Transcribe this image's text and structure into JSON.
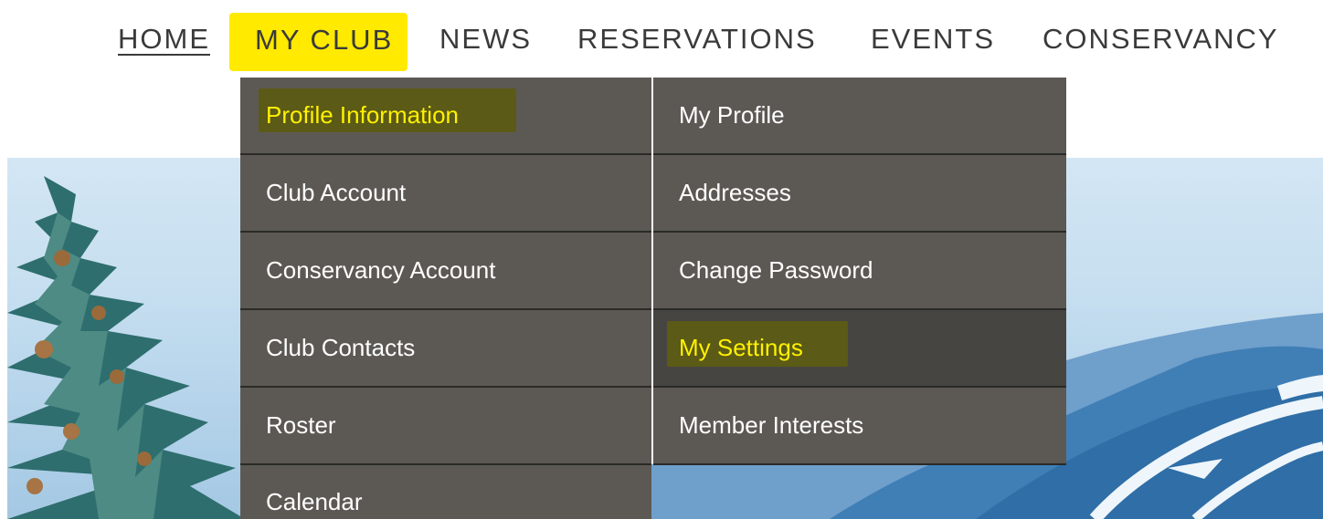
{
  "nav": {
    "items": [
      {
        "label": "HOME"
      },
      {
        "label": "MY CLUB"
      },
      {
        "label": "NEWS"
      },
      {
        "label": "RESERVATIONS"
      },
      {
        "label": "EVENTS"
      },
      {
        "label": "CONSERVANCY"
      }
    ],
    "active_highlight_color": "#ffea00"
  },
  "dropdown": {
    "left_column": [
      {
        "label": "Profile Information"
      },
      {
        "label": "Club Account"
      },
      {
        "label": "Conservancy Account"
      },
      {
        "label": "Club Contacts"
      },
      {
        "label": "Roster"
      },
      {
        "label": "Calendar"
      }
    ],
    "right_column": [
      {
        "label": "My Profile"
      },
      {
        "label": "Addresses"
      },
      {
        "label": "Change Password"
      },
      {
        "label": "My Settings"
      },
      {
        "label": "Member Interests"
      }
    ],
    "menu_bg_color": "#5c5954",
    "highlight_text_color": "#fff100"
  }
}
